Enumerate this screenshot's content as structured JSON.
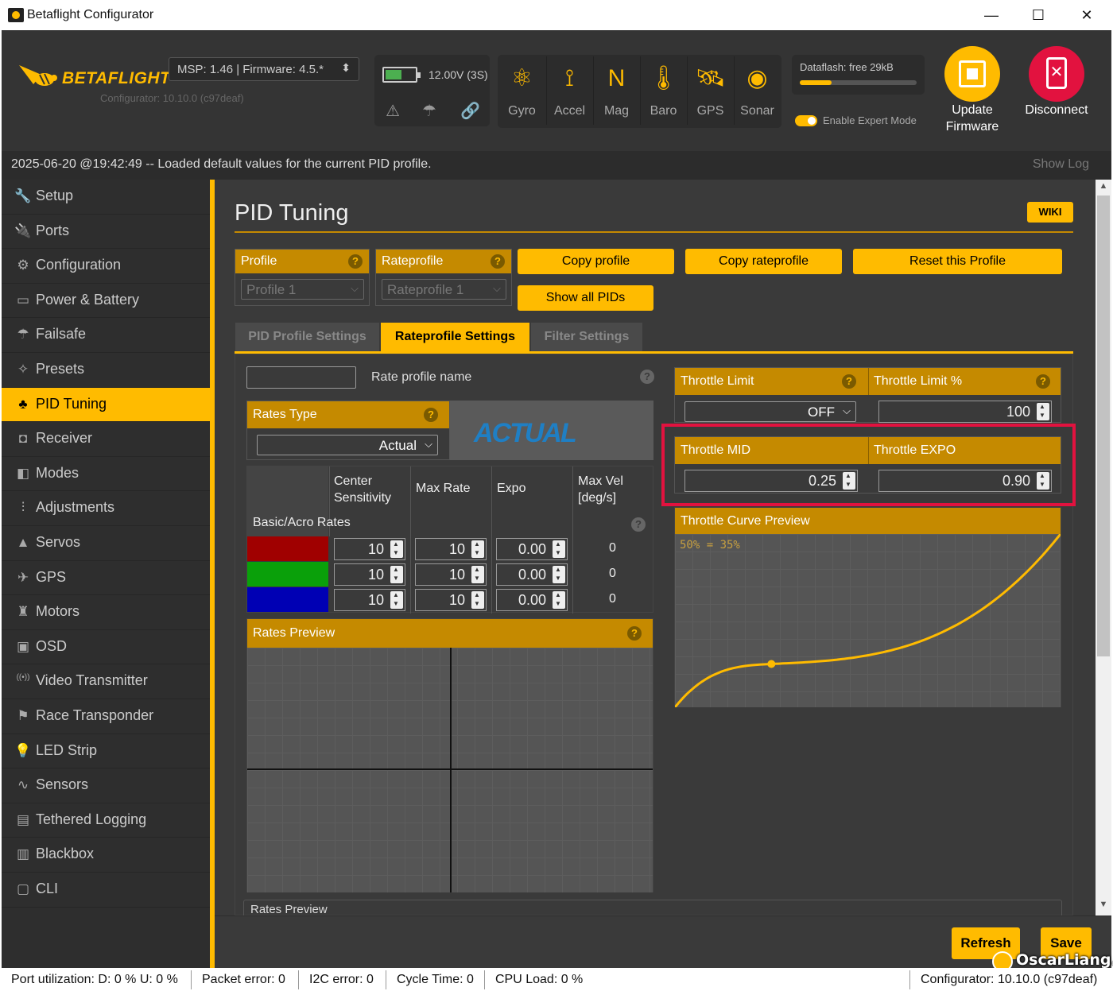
{
  "window": {
    "title": "Betaflight Configurator",
    "minimize": "—",
    "maximize": "☐",
    "close": "✕"
  },
  "header": {
    "logo": "BETAFLIGHT",
    "configurator_version": "Configurator: 10.10.0 (c97deaf)",
    "msp": "MSP: 1.46 | Firmware: 4.5.*",
    "battery": {
      "voltage": "12.00V (3S)",
      "level": 0.55
    },
    "sensors": [
      {
        "label": "Gyro",
        "icon": "gyro-icon",
        "glyph": "⚛"
      },
      {
        "label": "Accel",
        "icon": "accel-icon",
        "glyph": "⟟"
      },
      {
        "label": "Mag",
        "icon": "mag-icon",
        "glyph": "N"
      },
      {
        "label": "Baro",
        "icon": "baro-icon",
        "glyph": "🌡"
      },
      {
        "label": "GPS",
        "icon": "gps-icon",
        "glyph": "🛰"
      },
      {
        "label": "Sonar",
        "icon": "sonar-icon",
        "glyph": "◉"
      }
    ],
    "dataflash": "Dataflash: free 29kB",
    "expert_mode": "Enable Expert Mode",
    "update_firmware": "Update Firmware",
    "disconnect": "Disconnect"
  },
  "log": {
    "message": "2025-06-20 @19:42:49 -- Loaded default values for the current PID profile.",
    "show_log": "Show Log"
  },
  "sidebar": {
    "items": [
      {
        "label": "Setup",
        "glyph": "🔧",
        "active": false
      },
      {
        "label": "Ports",
        "glyph": "🔌",
        "active": false
      },
      {
        "label": "Configuration",
        "glyph": "⚙",
        "active": false
      },
      {
        "label": "Power & Battery",
        "glyph": "▭",
        "active": false
      },
      {
        "label": "Failsafe",
        "glyph": "☂",
        "active": false
      },
      {
        "label": "Presets",
        "glyph": "✧",
        "active": false
      },
      {
        "label": "PID Tuning",
        "glyph": "♣",
        "active": true
      },
      {
        "label": "Receiver",
        "glyph": "◘",
        "active": false
      },
      {
        "label": "Modes",
        "glyph": "◧",
        "active": false
      },
      {
        "label": "Adjustments",
        "glyph": "⫶",
        "active": false
      },
      {
        "label": "Servos",
        "glyph": "▲",
        "active": false
      },
      {
        "label": "GPS",
        "glyph": "✈",
        "active": false
      },
      {
        "label": "Motors",
        "glyph": "♜",
        "active": false
      },
      {
        "label": "OSD",
        "glyph": "▣",
        "active": false
      },
      {
        "label": "Video Transmitter",
        "glyph": "((•))",
        "active": false
      },
      {
        "label": "Race Transponder",
        "glyph": "⚑",
        "active": false
      },
      {
        "label": "LED Strip",
        "glyph": "💡",
        "active": false
      },
      {
        "label": "Sensors",
        "glyph": "∿",
        "active": false
      },
      {
        "label": "Tethered Logging",
        "glyph": "▤",
        "active": false
      },
      {
        "label": "Blackbox",
        "glyph": "▥",
        "active": false
      },
      {
        "label": "CLI",
        "glyph": "▢",
        "active": false
      }
    ]
  },
  "main": {
    "title": "PID Tuning",
    "wiki": "WIKI",
    "profile": {
      "label": "Profile",
      "value": "Profile 1"
    },
    "rateprofile": {
      "label": "Rateprofile",
      "value": "Rateprofile 1"
    },
    "buttons": {
      "copy_profile": "Copy profile",
      "copy_rateprofile": "Copy rateprofile",
      "reset_profile": "Reset this Profile",
      "show_all_pids": "Show all PIDs"
    },
    "tabs": [
      "PID Profile Settings",
      "Rateprofile Settings",
      "Filter Settings"
    ],
    "active_tab": 1,
    "rate_profile_name": {
      "label": "Rate profile name",
      "value": ""
    },
    "rates_type": {
      "label": "Rates Type",
      "value": "Actual",
      "logo": "ACTUAL"
    },
    "rates_table": {
      "headers": [
        "Center Sensitivity",
        "Max Rate",
        "Expo",
        "Max Vel [deg/s]"
      ],
      "section_label": "Basic/Acro Rates",
      "rows": [
        {
          "axis_color": "#a00000",
          "center": "10",
          "max_rate": "10",
          "expo": "0.00",
          "max_vel": "0"
        },
        {
          "axis_color": "#0aa00a",
          "center": "10",
          "max_rate": "10",
          "expo": "0.00",
          "max_vel": "0"
        },
        {
          "axis_color": "#0000b4",
          "center": "10",
          "max_rate": "10",
          "expo": "0.00",
          "max_vel": "0"
        }
      ]
    },
    "rates_preview": {
      "label": "Rates Preview"
    },
    "rates_preview_2": {
      "label": "Rates Preview"
    },
    "throttle_limit": {
      "label": "Throttle Limit",
      "value": "OFF"
    },
    "throttle_limit_pct": {
      "label": "Throttle Limit %",
      "value": "100"
    },
    "throttle_mid": {
      "label": "Throttle MID",
      "value": "0.25"
    },
    "throttle_expo": {
      "label": "Throttle EXPO",
      "value": "0.90"
    },
    "throttle_curve": {
      "label": "Throttle Curve Preview",
      "readout": "50% = 35%",
      "mid": 0.25,
      "expo": 0.9
    },
    "highlight_color": "#e2123f"
  },
  "footer": {
    "refresh": "Refresh",
    "save": "Save"
  },
  "status": {
    "port_util": "Port utilization: D: 0 % U: 0 %",
    "packet_error": "Packet error: 0",
    "i2c_error": "I2C error: 0",
    "cycle_time": "Cycle Time: 0",
    "cpu_load": "CPU Load: 0 %",
    "version": "Configurator: 10.10.0 (c97deaf)"
  },
  "watermark": "OscarLiang.com"
}
